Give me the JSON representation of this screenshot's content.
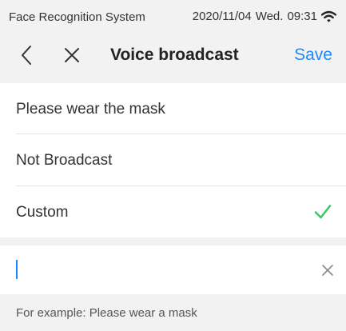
{
  "status_bar": {
    "app_name": "Face Recognition System",
    "date": "2020/11/04",
    "weekday": "Wed.",
    "time": "09:31",
    "wifi_icon": "wifi-icon"
  },
  "header": {
    "back_icon": "chevron-left-icon",
    "close_icon": "close-icon",
    "title": "Voice broadcast",
    "save_label": "Save",
    "save_color": "#1e88ff"
  },
  "options": [
    {
      "label": "Please wear the mask",
      "selected": false
    },
    {
      "label": "Not Broadcast",
      "selected": false
    },
    {
      "label": "Custom",
      "selected": true
    }
  ],
  "check_icon": "check-icon",
  "check_color": "#3cc86a",
  "custom_input": {
    "value": "",
    "clear_icon": "close-icon"
  },
  "hint": "For example: Please wear a mask"
}
